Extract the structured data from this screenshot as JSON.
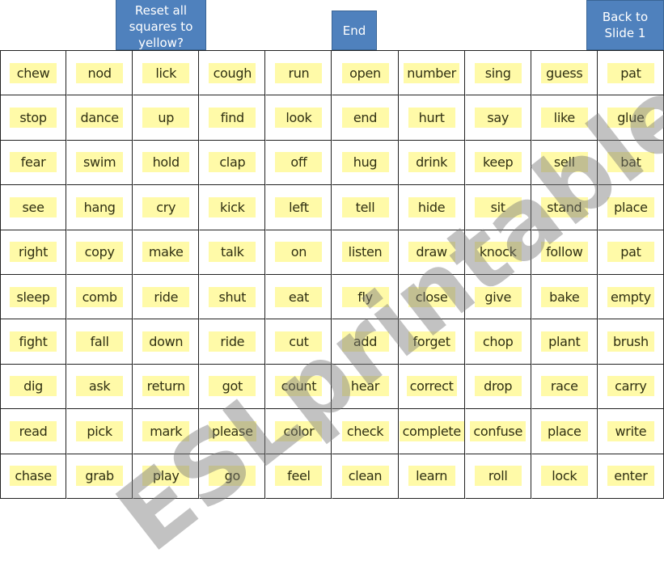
{
  "buttons": {
    "reset": "Reset all\nsquares to\nyellow?",
    "end": "End",
    "back": "Back to\nSlide 1"
  },
  "colors": {
    "button_bg": "#4f81bd",
    "square_highlight": "#fffaa8",
    "grid_line": "#222222"
  },
  "watermark": "ESLprintables.com",
  "rows": [
    [
      "chew",
      "nod",
      "lick",
      "cough",
      "run",
      "open",
      "number",
      "sing",
      "guess",
      "pat"
    ],
    [
      "stop",
      "dance",
      "up",
      "find",
      "look",
      "end",
      "hurt",
      "say",
      "like",
      "glue"
    ],
    [
      "fear",
      "swim",
      "hold",
      "clap",
      "off",
      "hug",
      "drink",
      "keep",
      "sell",
      "bat"
    ],
    [
      "see",
      "hang",
      "cry",
      "kick",
      "left",
      "tell",
      "hide",
      "sit",
      "stand",
      "place"
    ],
    [
      "right",
      "copy",
      "make",
      "talk",
      "on",
      "listen",
      "draw",
      "knock",
      "follow",
      "pat"
    ],
    [
      "sleep",
      "comb",
      "ride",
      "shut",
      "eat",
      "fly",
      "close",
      "give",
      "bake",
      "empty"
    ],
    [
      "fight",
      "fall",
      "down",
      "ride",
      "cut",
      "add",
      "forget",
      "chop",
      "plant",
      "brush"
    ],
    [
      "dig",
      "ask",
      "return",
      "got",
      "count",
      "hear",
      "correct",
      "drop",
      "race",
      "carry"
    ],
    [
      "read",
      "pick",
      "mark",
      "please",
      "color",
      "check",
      "complete",
      "confuse",
      "place",
      "write"
    ],
    [
      "chase",
      "grab",
      "play",
      "go",
      "feel",
      "clean",
      "learn",
      "roll",
      "lock",
      "enter"
    ]
  ]
}
